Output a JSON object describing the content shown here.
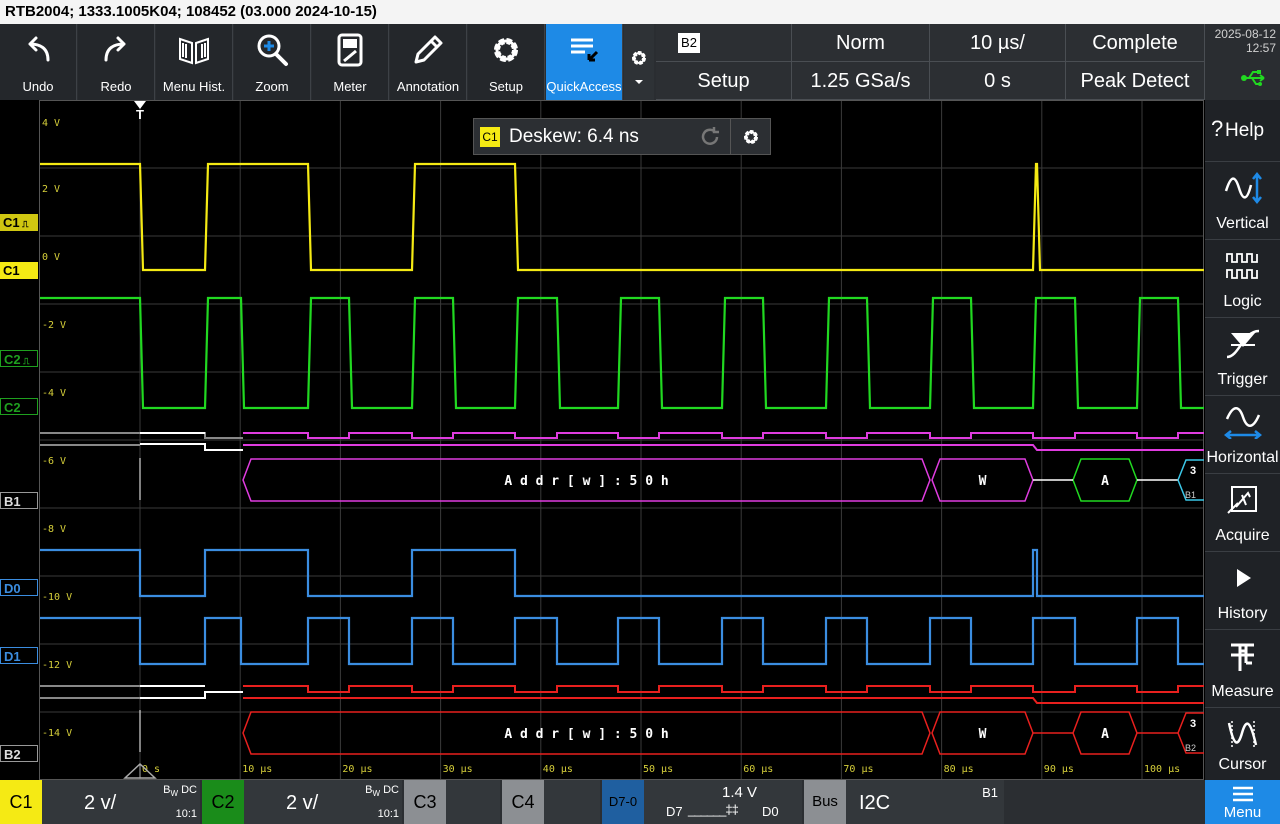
{
  "title": "RTB2004; 1333.1005K04; 108452 (03.000 2024-10-15)",
  "toolbar": {
    "buttons": [
      {
        "label": "Undo",
        "icon": "undo-icon"
      },
      {
        "label": "Redo",
        "icon": "redo-icon"
      },
      {
        "label": "Menu Hist.",
        "icon": "menu-history-icon"
      },
      {
        "label": "Zoom",
        "icon": "zoom-icon"
      },
      {
        "label": "Meter",
        "icon": "meter-icon"
      },
      {
        "label": "Annotation",
        "icon": "pencil-icon"
      },
      {
        "label": "Setup",
        "icon": "gear-icon"
      },
      {
        "label": "QuickAccess",
        "icon": "quickaccess-icon"
      }
    ],
    "bus_badge": "B2",
    "bus_setup": "Setup",
    "trigger_mode": "Norm",
    "timebase": "10 µs/",
    "acq_state": "Complete",
    "sample_rate": "1.25 GSa/s",
    "time_offset": "0 s",
    "acq_mode": "Peak Detect"
  },
  "datetime": {
    "date": "2025-08-12",
    "time": "12:57"
  },
  "side_panel": [
    {
      "label": "Help",
      "icon": "help-icon"
    },
    {
      "label": "Vertical",
      "icon": "vertical-icon"
    },
    {
      "label": "Logic",
      "icon": "logic-icon"
    },
    {
      "label": "Trigger",
      "icon": "trigger-icon"
    },
    {
      "label": "Horizontal",
      "icon": "horizontal-icon"
    },
    {
      "label": "Acquire",
      "icon": "acquire-icon"
    },
    {
      "label": "History",
      "icon": "play-icon"
    },
    {
      "label": "Measure",
      "icon": "measure-icon"
    },
    {
      "label": "Cursor",
      "icon": "cursor-icon"
    }
  ],
  "deskew": {
    "channel": "C1",
    "text": "Deskew: 6.4 ns"
  },
  "y_labels": [
    "4 V",
    "2 V",
    "0 V",
    "-2 V",
    "-4 V",
    "-6 V",
    "-8 V",
    "-10 V",
    "-12 V",
    "-14 V"
  ],
  "x_labels": [
    "0 s",
    "10 µs",
    "20 µs",
    "30 µs",
    "40 µs",
    "50 µs",
    "60 µs",
    "70 µs",
    "80 µs",
    "90 µs",
    "100 µs"
  ],
  "trigger_marker": "T",
  "channel_tags": [
    "C1",
    "C1",
    "C2",
    "C2",
    "B1",
    "D0",
    "D1",
    "B2"
  ],
  "bus_decode": {
    "b1": {
      "addr": "A d d r [ w ] : 5 0 h",
      "rw": "W",
      "ack": "A",
      "next": "3",
      "tag": "B1"
    },
    "b2": {
      "addr": "A d d r [ w ] : 5 0 h",
      "rw": "W",
      "ack": "A",
      "next": "3",
      "tag": "B2"
    }
  },
  "bottom": {
    "c1": {
      "name": "C1",
      "scale": "2 v/",
      "bw": "B",
      "bw_sub": "W",
      "coupling": "DC",
      "probe": "10:1"
    },
    "c2": {
      "name": "C2",
      "scale": "2 v/",
      "bw": "B",
      "bw_sub": "W",
      "coupling": "DC",
      "probe": "10:1"
    },
    "c3": {
      "name": "C3"
    },
    "c4": {
      "name": "C4"
    },
    "logic": {
      "name": "D7-0",
      "threshold": "1.4 V",
      "lo": "D7",
      "hi": "D0"
    },
    "bus": {
      "name": "Bus",
      "protocol": "I2C",
      "bus_id": "B1"
    }
  },
  "menu": "Menu",
  "colors": {
    "c1": "#f5ea14",
    "c2": "#21d921",
    "b1": "#e03ce0",
    "d": "#3b8de0",
    "b2": "#e8201e",
    "ack": "#21d921",
    "accent": "#1e8ae6"
  }
}
